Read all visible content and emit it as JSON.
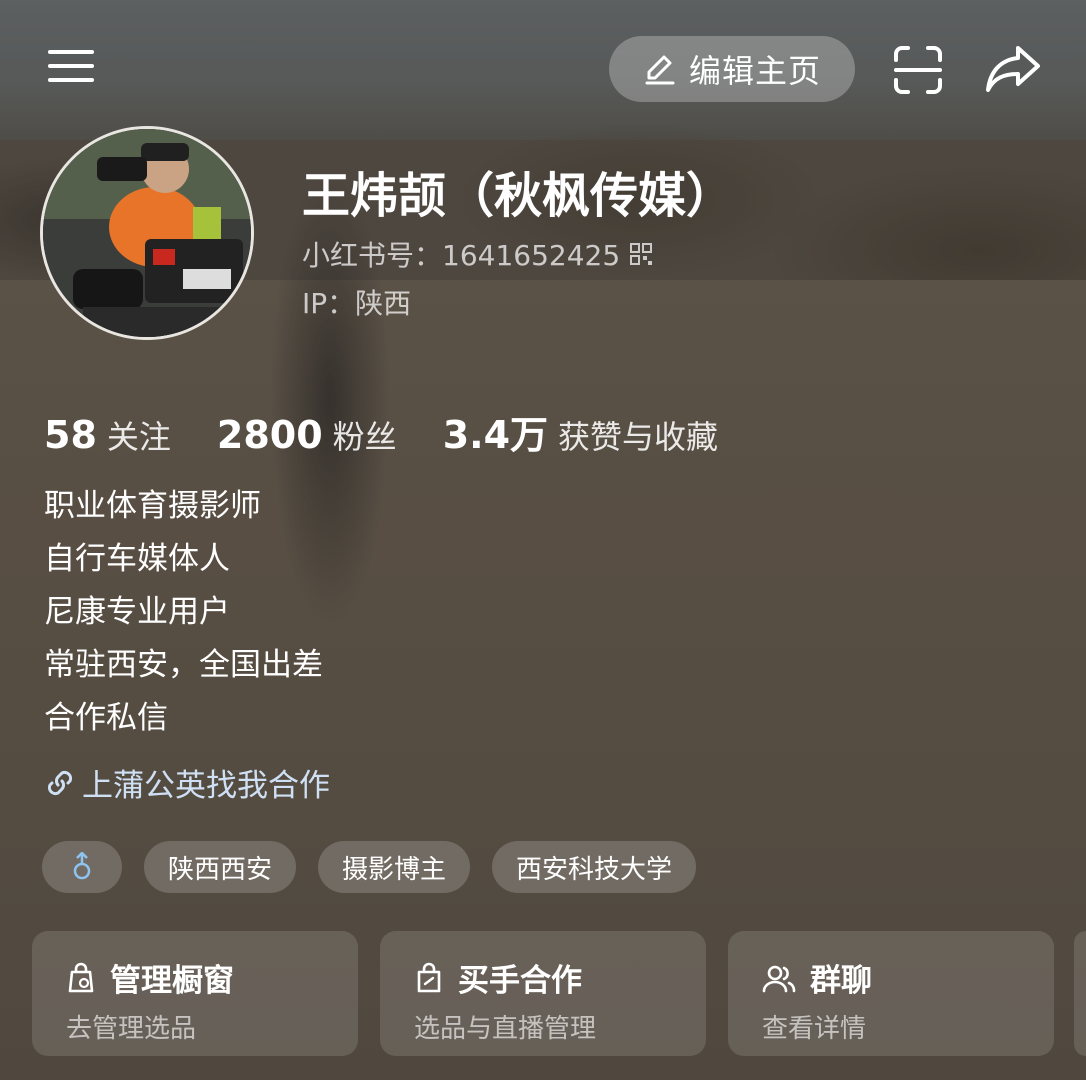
{
  "header": {
    "menu_icon": "menu-icon",
    "edit_label": "编辑主页",
    "scan_icon": "scan-icon",
    "share_icon": "share-icon"
  },
  "profile": {
    "name": "王炜颉（秋枫传媒）",
    "id_text": "小红书号：1641652425",
    "ip_text": "IP：陕西"
  },
  "stats": [
    {
      "value": "58",
      "label": "关注"
    },
    {
      "value": "2800",
      "label": "粉丝"
    },
    {
      "value": "3.4万",
      "label": "获赞与收藏"
    }
  ],
  "bio": [
    "职业体育摄影师",
    "自行车媒体人",
    "尼康专业用户",
    "常驻西安，全国出差",
    "合作私信"
  ],
  "link": {
    "text": "上蒲公英找我合作",
    "icon": "link-icon"
  },
  "tags": {
    "gender_icon": "male-icon",
    "items": [
      "陕西西安",
      "摄影博主",
      "西安科技大学"
    ]
  },
  "cards": [
    {
      "title": "管理橱窗",
      "subtitle": "去管理选品",
      "icon": "shop-bag-icon"
    },
    {
      "title": "买手合作",
      "subtitle": "选品与直播管理",
      "icon": "buyer-bag-icon"
    },
    {
      "title": "群聊",
      "subtitle": "查看详情",
      "icon": "group-chat-icon"
    }
  ],
  "colors": {
    "link": "#cfe0f4",
    "gender": "#8fc3f0"
  }
}
